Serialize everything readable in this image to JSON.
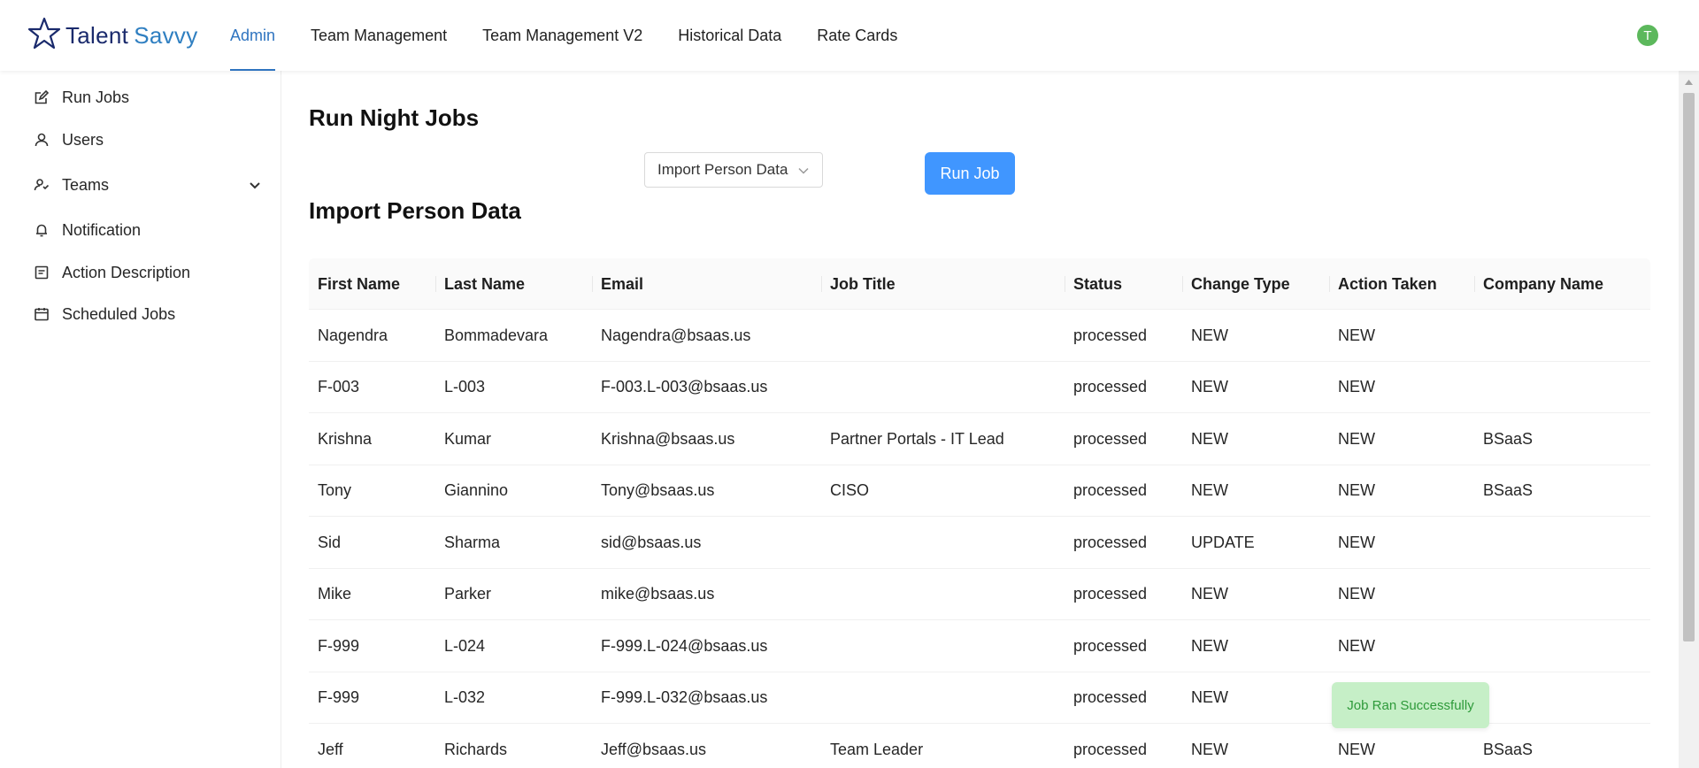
{
  "app": {
    "logo_word1": "Talent",
    "logo_word2": "Savvy",
    "avatar_initial": "T"
  },
  "nav": {
    "items": [
      "Admin",
      "Team Management",
      "Team Management V2",
      "Historical Data",
      "Rate Cards"
    ],
    "active": "Admin"
  },
  "sidebar": {
    "items": [
      {
        "label": "Run Jobs",
        "icon": "edit-icon"
      },
      {
        "label": "Users",
        "icon": "user-icon"
      },
      {
        "label": "Teams",
        "icon": "team-icon",
        "expandable": true
      },
      {
        "label": "Notification",
        "icon": "bell-icon"
      },
      {
        "label": "Action Description",
        "icon": "document-icon"
      },
      {
        "label": "Scheduled Jobs",
        "icon": "calendar-icon"
      }
    ]
  },
  "main": {
    "page_title": "Run Night Jobs",
    "job_select_value": "Import Person Data",
    "run_button_label": "Run Job",
    "section_title": "Import Person Data"
  },
  "table": {
    "columns": [
      "First Name",
      "Last Name",
      "Email",
      "Job Title",
      "Status",
      "Change Type",
      "Action Taken",
      "Company Name"
    ],
    "rows": [
      [
        "Nagendra",
        "Bommadevara",
        "Nagendra@bsaas.us",
        "",
        "processed",
        "NEW",
        "NEW",
        ""
      ],
      [
        "F-003",
        "L-003",
        "F-003.L-003@bsaas.us",
        "",
        "processed",
        "NEW",
        "NEW",
        ""
      ],
      [
        "Krishna",
        "Kumar",
        "Krishna@bsaas.us",
        "Partner Portals - IT Lead",
        "processed",
        "NEW",
        "NEW",
        "BSaaS"
      ],
      [
        "Tony",
        "Giannino",
        "Tony@bsaas.us",
        "CISO",
        "processed",
        "NEW",
        "NEW",
        "BSaaS"
      ],
      [
        "Sid",
        "Sharma",
        "sid@bsaas.us",
        "",
        "processed",
        "UPDATE",
        "NEW",
        ""
      ],
      [
        "Mike",
        "Parker",
        "mike@bsaas.us",
        "",
        "processed",
        "NEW",
        "NEW",
        ""
      ],
      [
        "F-999",
        "L-024",
        "F-999.L-024@bsaas.us",
        "",
        "processed",
        "NEW",
        "NEW",
        ""
      ],
      [
        "F-999",
        "L-032",
        "F-999.L-032@bsaas.us",
        "",
        "processed",
        "NEW",
        "",
        ""
      ],
      [
        "Jeff",
        "Richards",
        "Jeff@bsaas.us",
        "Team Leader",
        "processed",
        "NEW",
        "NEW",
        "BSaaS"
      ]
    ]
  },
  "toast": {
    "message": "Job Ran Successfully"
  },
  "colors": {
    "accent": "#2f74c0",
    "primary_button": "#4096ff",
    "avatar": "#5cb85c",
    "toast_bg": "#c6efc7",
    "toast_text": "#2e9a3a"
  }
}
